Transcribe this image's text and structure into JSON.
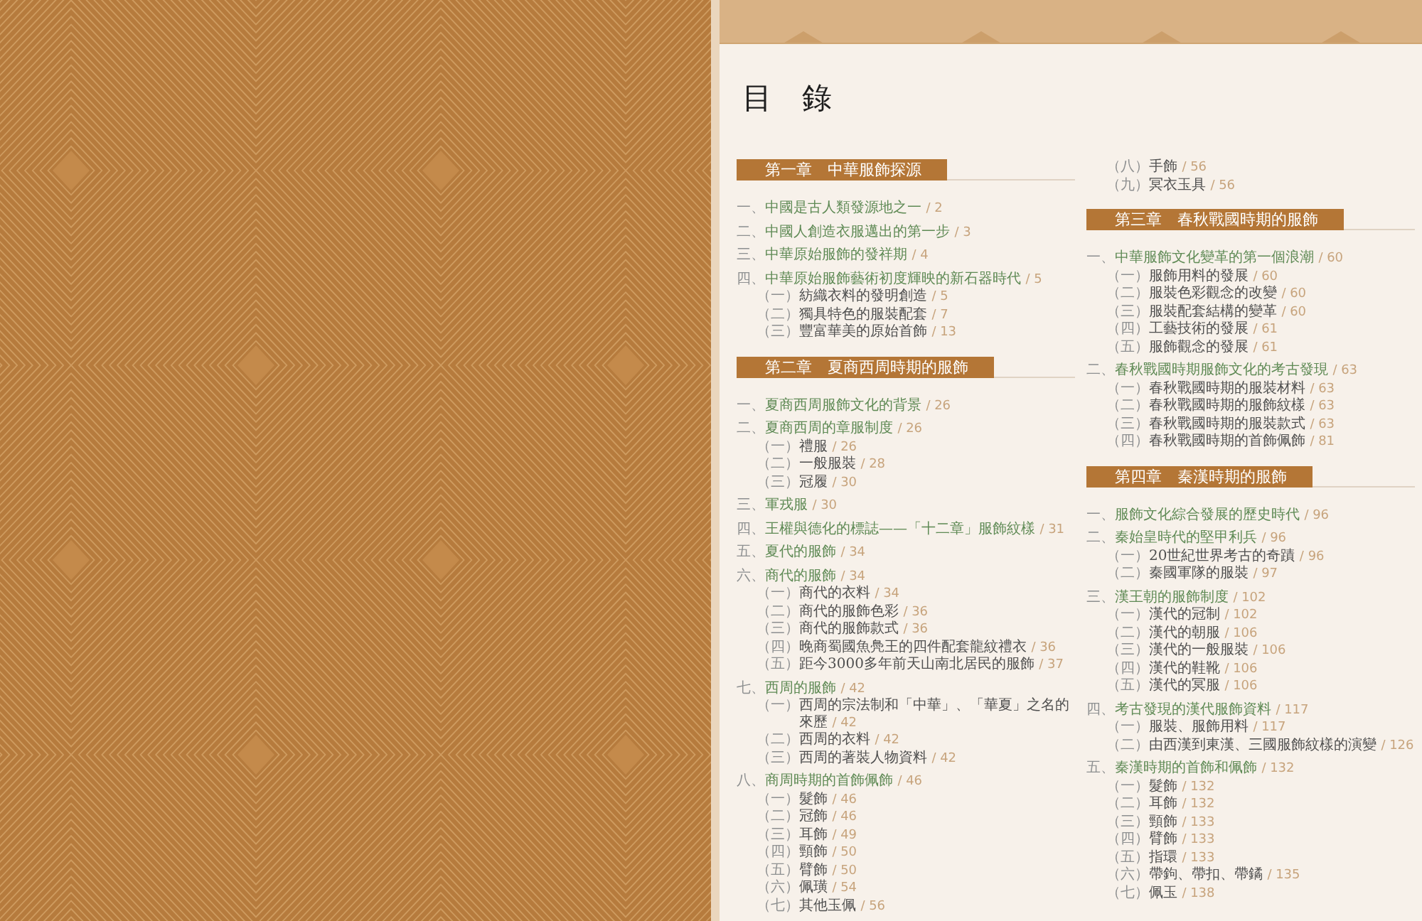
{
  "page_title": "目　錄",
  "columns": [
    {
      "chapters": [
        {
          "title": "第一章　中華服飾探源",
          "children": [
            {
              "num": "一、",
              "title": "中國是古人類發源地之一",
              "page": "/ 2"
            },
            {
              "num": "二、",
              "title": "中國人創造衣服邁出的第一步",
              "page": "/ 3"
            },
            {
              "num": "三、",
              "title": "中華原始服飾的發祥期",
              "page": "/ 4"
            },
            {
              "num": "四、",
              "title": "中華原始服飾藝術初度輝映的新石器時代",
              "page": "/ 5",
              "children": [
                {
                  "num": "（一）",
                  "title": "紡織衣料的發明創造",
                  "page": "/ 5"
                },
                {
                  "num": "（二）",
                  "title": "獨具特色的服裝配套",
                  "page": "/ 7"
                },
                {
                  "num": "（三）",
                  "title": "豐富華美的原始首飾",
                  "page": "/ 13"
                }
              ]
            }
          ]
        },
        {
          "title": "第二章　夏商西周時期的服飾",
          "children": [
            {
              "num": "一、",
              "title": "夏商西周服飾文化的背景",
              "page": "/ 26"
            },
            {
              "num": "二、",
              "title": "夏商西周的章服制度",
              "page": "/ 26",
              "children": [
                {
                  "num": "（一）",
                  "title": "禮服",
                  "page": "/ 26"
                },
                {
                  "num": "（二）",
                  "title": "一般服裝",
                  "page": "/ 28"
                },
                {
                  "num": "（三）",
                  "title": "冠履",
                  "page": "/ 30"
                }
              ]
            },
            {
              "num": "三、",
              "title": "軍戎服",
              "page": "/ 30"
            },
            {
              "num": "四、",
              "title": "王權與德化的標誌——「十二章」服飾紋樣",
              "page": "/ 31"
            },
            {
              "num": "五、",
              "title": "夏代的服飾",
              "page": "/ 34"
            },
            {
              "num": "六、",
              "title": "商代的服飾",
              "page": "/ 34",
              "children": [
                {
                  "num": "（一）",
                  "title": "商代的衣料",
                  "page": "/ 34"
                },
                {
                  "num": "（二）",
                  "title": "商代的服飾色彩",
                  "page": "/ 36"
                },
                {
                  "num": "（三）",
                  "title": "商代的服飾款式",
                  "page": "/ 36"
                },
                {
                  "num": "（四）",
                  "title": "晚商蜀國魚鳧王的四件配套龍紋禮衣",
                  "page": "/ 36"
                },
                {
                  "num": "（五）",
                  "title": "距今3000多年前天山南北居民的服飾",
                  "page": "/ 37"
                }
              ]
            },
            {
              "num": "七、",
              "title": "西周的服飾",
              "page": "/ 42",
              "children": [
                {
                  "num": "（一）",
                  "title": "西周的宗法制和「中華」、「華夏」之名的來歷",
                  "page": "/ 42"
                },
                {
                  "num": "（二）",
                  "title": "西周的衣料",
                  "page": "/ 42"
                },
                {
                  "num": "（三）",
                  "title": "西周的著裝人物資料",
                  "page": "/ 42"
                }
              ]
            },
            {
              "num": "八、",
              "title": "商周時期的首飾佩飾",
              "page": "/ 46",
              "children": [
                {
                  "num": "（一）",
                  "title": "髮飾",
                  "page": "/ 46"
                },
                {
                  "num": "（二）",
                  "title": "冠飾",
                  "page": "/ 46"
                },
                {
                  "num": "（三）",
                  "title": "耳飾",
                  "page": "/ 49"
                },
                {
                  "num": "（四）",
                  "title": "頸飾",
                  "page": "/ 50"
                },
                {
                  "num": "（五）",
                  "title": "臂飾",
                  "page": "/ 50"
                },
                {
                  "num": "（六）",
                  "title": "佩璜",
                  "page": "/ 54"
                },
                {
                  "num": "（七）",
                  "title": "其他玉佩",
                  "page": "/ 56"
                }
              ]
            }
          ]
        }
      ]
    },
    {
      "continued": [
        {
          "num": "（八）",
          "title": "手飾",
          "page": "/ 56"
        },
        {
          "num": "（九）",
          "title": "冥衣玉具",
          "page": "/ 56"
        }
      ],
      "chapters": [
        {
          "title": "第三章　春秋戰國時期的服飾",
          "children": [
            {
              "num": "一、",
              "title": "中華服飾文化變革的第一個浪潮",
              "page": "/ 60",
              "children": [
                {
                  "num": "（一）",
                  "title": "服飾用料的發展",
                  "page": "/ 60"
                },
                {
                  "num": "（二）",
                  "title": "服裝色彩觀念的改變",
                  "page": "/ 60"
                },
                {
                  "num": "（三）",
                  "title": "服裝配套結構的變革",
                  "page": "/ 60"
                },
                {
                  "num": "（四）",
                  "title": "工藝技術的發展",
                  "page": "/ 61"
                },
                {
                  "num": "（五）",
                  "title": "服飾觀念的發展",
                  "page": "/ 61"
                }
              ]
            },
            {
              "num": "二、",
              "title": "春秋戰國時期服飾文化的考古發現",
              "page": "/ 63",
              "children": [
                {
                  "num": "（一）",
                  "title": "春秋戰國時期的服裝材料",
                  "page": "/ 63"
                },
                {
                  "num": "（二）",
                  "title": "春秋戰國時期的服飾紋樣",
                  "page": "/ 63"
                },
                {
                  "num": "（三）",
                  "title": "春秋戰國時期的服裝款式",
                  "page": "/ 63"
                },
                {
                  "num": "（四）",
                  "title": "春秋戰國時期的首飾佩飾",
                  "page": "/ 81"
                }
              ]
            }
          ]
        },
        {
          "title": "第四章　秦漢時期的服飾",
          "children": [
            {
              "num": "一、",
              "title": "服飾文化綜合發展的歷史時代",
              "page": "/ 96"
            },
            {
              "num": "二、",
              "title": "秦始皇時代的堅甲利兵",
              "page": "/ 96",
              "children": [
                {
                  "num": "（一）",
                  "title": "20世紀世界考古的奇蹟",
                  "page": "/ 96"
                },
                {
                  "num": "（二）",
                  "title": "秦國軍隊的服裝",
                  "page": "/ 97"
                }
              ]
            },
            {
              "num": "三、",
              "title": "漢王朝的服飾制度",
              "page": "/ 102",
              "children": [
                {
                  "num": "（一）",
                  "title": "漢代的冠制",
                  "page": "/ 102"
                },
                {
                  "num": "（二）",
                  "title": "漢代的朝服",
                  "page": "/ 106"
                },
                {
                  "num": "（三）",
                  "title": "漢代的一般服裝",
                  "page": "/ 106"
                },
                {
                  "num": "（四）",
                  "title": "漢代的鞋靴",
                  "page": "/ 106"
                },
                {
                  "num": "（五）",
                  "title": "漢代的冥服",
                  "page": "/ 106"
                }
              ]
            },
            {
              "num": "四、",
              "title": "考古發現的漢代服飾資料",
              "page": "/ 117",
              "children": [
                {
                  "num": "（一）",
                  "title": "服裝、服飾用料",
                  "page": "/ 117"
                },
                {
                  "num": "（二）",
                  "title": "由西漢到東漢、三國服飾紋樣的演變",
                  "page": "/ 126"
                }
              ]
            },
            {
              "num": "五、",
              "title": "秦漢時期的首飾和佩飾",
              "page": "/ 132",
              "children": [
                {
                  "num": "（一）",
                  "title": "髮飾",
                  "page": "/ 132"
                },
                {
                  "num": "（二）",
                  "title": "耳飾",
                  "page": "/ 132"
                },
                {
                  "num": "（三）",
                  "title": "頸飾",
                  "page": "/ 133"
                },
                {
                  "num": "（四）",
                  "title": "臂飾",
                  "page": "/ 133"
                },
                {
                  "num": "（五）",
                  "title": "指環",
                  "page": "/ 133"
                },
                {
                  "num": "（六）",
                  "title": "帶鉤、帶扣、帶鐍",
                  "page": "/ 135"
                },
                {
                  "num": "（七）",
                  "title": "佩玉",
                  "page": "/ 138"
                }
              ]
            }
          ]
        }
      ]
    }
  ]
}
